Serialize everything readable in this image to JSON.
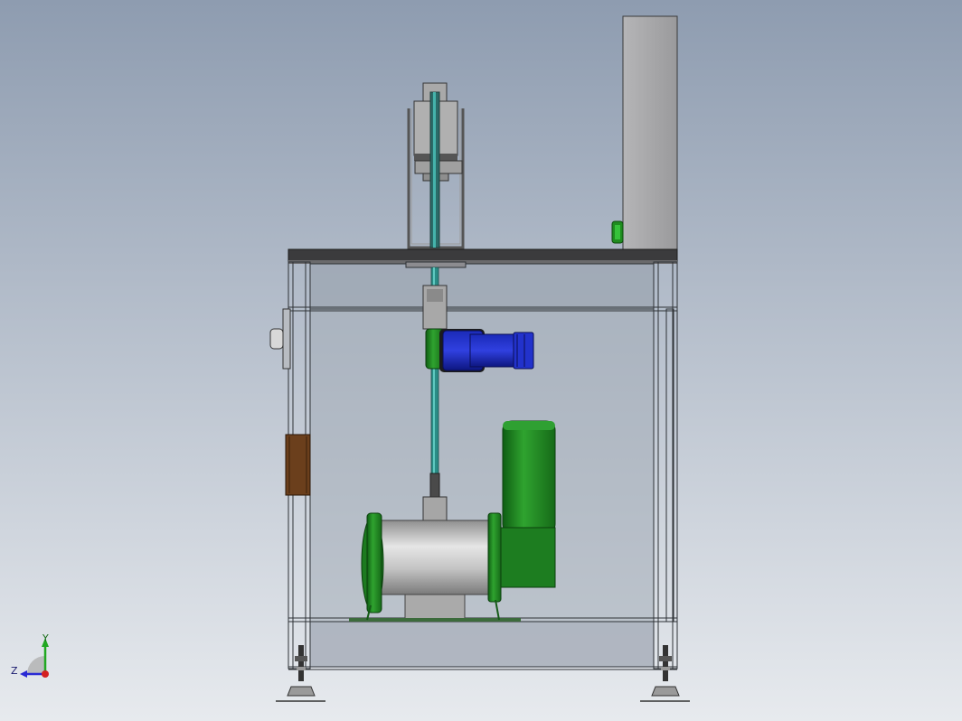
{
  "viewport": {
    "background_top": "#8e9cb0",
    "background_bottom": "#e7eaee"
  },
  "colors": {
    "frame_line": "#2f3338",
    "panel_fill": "#9ea6b2",
    "panel_light": "#b7bec8",
    "table_top": "#3a3a3c",
    "cabinet_grey": "#a8a8aa",
    "motor_green": "#1e7d22",
    "motor_green_dark": "#0f4f12",
    "motor_green_light": "#4fb64b",
    "gear_blue": "#1f2fc7",
    "gear_blue_dark": "#0d1680",
    "shaft_teal": "#2a8c86",
    "brown_box": "#6a3f1c",
    "drum_grey": "#b4b4b4"
  },
  "triad": {
    "x_label": "",
    "y_label": "Y",
    "z_label": "Z",
    "x_color": "#d42020",
    "y_color": "#21a821",
    "z_color": "#2a2ad4"
  },
  "parts": {
    "control_cabinet": "control-cabinet",
    "green_button": "green-push-button",
    "worktable_top": "worktable-top",
    "upper_clamp": "upper-clamp-assembly",
    "blue_motor": "blue-gear-motor",
    "green_motor": "green-drive-motor",
    "drum": "winding-drum",
    "shaft": "vertical-shaft",
    "side_box": "side-terminal-box",
    "left_foot": "leveling-foot-left",
    "right_foot": "leveling-foot-right"
  }
}
